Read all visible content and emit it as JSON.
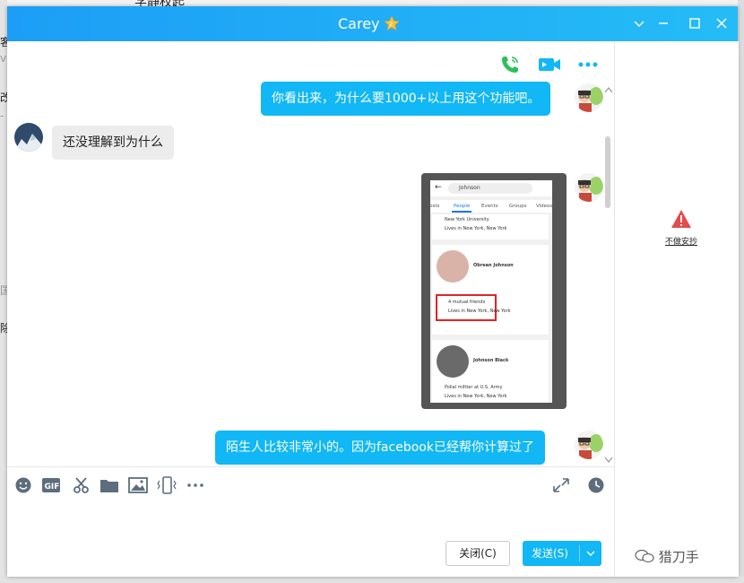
{
  "window": {
    "title": "Carey"
  },
  "background": {
    "left_chars": [
      "客",
      "v",
      "改",
      "-",
      "国",
      "除"
    ],
    "top_text": "学静权起"
  },
  "messages": [
    {
      "dir": "out",
      "text": "你看出来，为什么要1000+以上用这个功能吧。"
    },
    {
      "dir": "in",
      "text": "还没理解到为什么"
    },
    {
      "dir": "out",
      "kind": "image"
    },
    {
      "dir": "out",
      "text": "陌生人比较非常小的。因为facebook已经帮你计算过了"
    }
  ],
  "screenshot": {
    "search": "Johnson",
    "tabs": [
      "Posts",
      "People",
      "Events",
      "Groups",
      "Videos"
    ],
    "active_tab": "People",
    "card1": {
      "school": "New York University",
      "lives": "Lives in New York, New York"
    },
    "card2": {
      "name": "Obrean Johnson",
      "mutual": "4 mutual friends",
      "lives": "Lives in New York, New York"
    },
    "card3": {
      "name": "Johnson Black",
      "job": "Polial miltter at U.S. Army",
      "lives": "Lives in New York, New York"
    }
  },
  "side": {
    "report_label": "不做安抄"
  },
  "buttons": {
    "close": "关闭(C)",
    "send": "发送(S)"
  },
  "watermark": "猎刀手",
  "colors": {
    "title_grad_start": "#1c9ef6",
    "title_grad_end": "#25bcf6",
    "bubble_out": "#12b7f5",
    "bubble_in": "#ececec",
    "send_btn": "#12b7f5"
  }
}
